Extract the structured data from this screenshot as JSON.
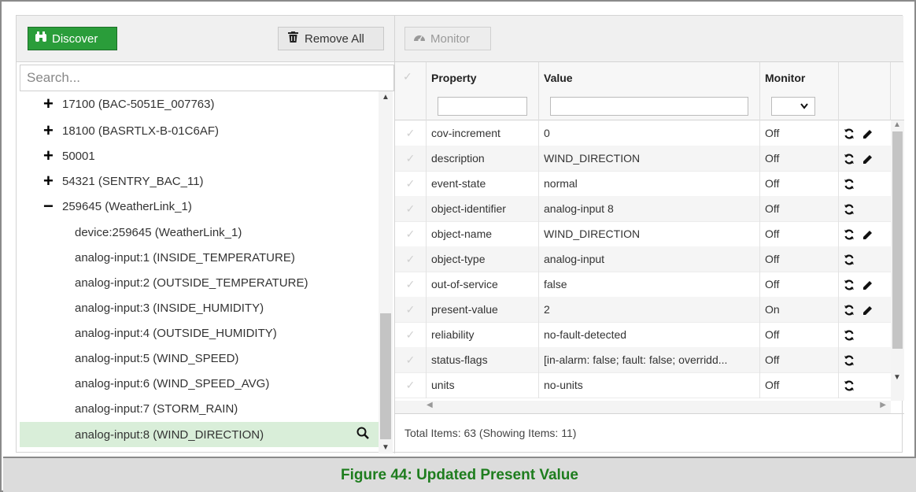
{
  "toolbar": {
    "discover_label": "Discover",
    "remove_all_label": "Remove All",
    "monitor_label": "Monitor"
  },
  "search": {
    "placeholder": "Search..."
  },
  "tree": {
    "devices": [
      {
        "label": "17100 (BAC-5051E_007763)",
        "expanded": false
      },
      {
        "label": "18100 (BASRTLX-B-01C6AF)",
        "expanded": false
      },
      {
        "label": "50001",
        "expanded": false
      },
      {
        "label": "54321 (SENTRY_BAC_11)",
        "expanded": false
      },
      {
        "label": "259645 (WeatherLink_1)",
        "expanded": true
      }
    ],
    "objects": [
      "device:259645 (WeatherLink_1)",
      "analog-input:1 (INSIDE_TEMPERATURE)",
      "analog-input:2 (OUTSIDE_TEMPERATURE)",
      "analog-input:3 (INSIDE_HUMIDITY)",
      "analog-input:4 (OUTSIDE_HUMIDITY)",
      "analog-input:5 (WIND_SPEED)",
      "analog-input:6 (WIND_SPEED_AVG)",
      "analog-input:7 (STORM_RAIN)",
      "analog-input:8 (WIND_DIRECTION)"
    ],
    "selected": "analog-input:8 (WIND_DIRECTION)"
  },
  "grid": {
    "headers": {
      "property": "Property",
      "value": "Value",
      "monitor": "Monitor"
    },
    "rows": [
      {
        "property": "cov-increment",
        "value": "0",
        "monitor": "Off",
        "editable": true
      },
      {
        "property": "description",
        "value": "WIND_DIRECTION",
        "monitor": "Off",
        "editable": true
      },
      {
        "property": "event-state",
        "value": "normal",
        "monitor": "Off",
        "editable": false
      },
      {
        "property": "object-identifier",
        "value": "analog-input 8",
        "monitor": "Off",
        "editable": false
      },
      {
        "property": "object-name",
        "value": "WIND_DIRECTION",
        "monitor": "Off",
        "editable": true
      },
      {
        "property": "object-type",
        "value": "analog-input",
        "monitor": "Off",
        "editable": false
      },
      {
        "property": "out-of-service",
        "value": "false",
        "monitor": "Off",
        "editable": true
      },
      {
        "property": "present-value",
        "value": "2",
        "monitor": "On",
        "editable": true
      },
      {
        "property": "reliability",
        "value": "no-fault-detected",
        "monitor": "Off",
        "editable": false
      },
      {
        "property": "status-flags",
        "value": "[in-alarm: false; fault: false; overridd...",
        "monitor": "Off",
        "editable": false
      },
      {
        "property": "units",
        "value": "no-units",
        "monitor": "Off",
        "editable": false
      }
    ],
    "footer": "Total Items: 63 (Showing Items: 11)"
  },
  "caption": "Figure 44: Updated Present Value",
  "colors": {
    "accent": "#2a9d3a",
    "caption": "#1e7d1e",
    "selected_row": "#d9eed9"
  },
  "icons": {
    "discover": "binoculars-icon",
    "remove_all": "trash-icon",
    "monitor": "dashboard-icon",
    "refresh": "refresh-icon",
    "edit": "pencil-icon",
    "search": "magnifier-icon"
  }
}
